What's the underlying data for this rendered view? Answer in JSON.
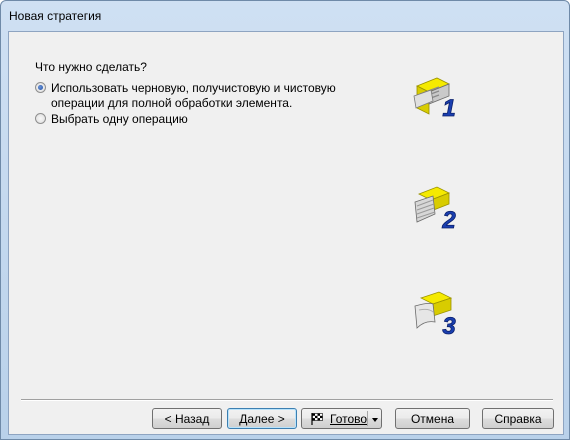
{
  "window": {
    "title": "Новая стратегия"
  },
  "question": "Что нужно сделать?",
  "options": [
    {
      "line1": "Использовать черновую, получистовую и чистовую",
      "line2": "операции для полной обработки элемента.",
      "selected": true
    },
    {
      "line1": "Выбрать одну операцию",
      "selected": false
    }
  ],
  "illustrations": [
    {
      "number": "1"
    },
    {
      "number": "2"
    },
    {
      "number": "3"
    }
  ],
  "colors": {
    "accent_yellow": "#f5ea00",
    "number_blue": "#1a3fb0"
  },
  "buttons": {
    "back": "< Назад",
    "next": "Далее >",
    "finish": "Готово",
    "cancel": "Отмена",
    "help": "Справка"
  }
}
